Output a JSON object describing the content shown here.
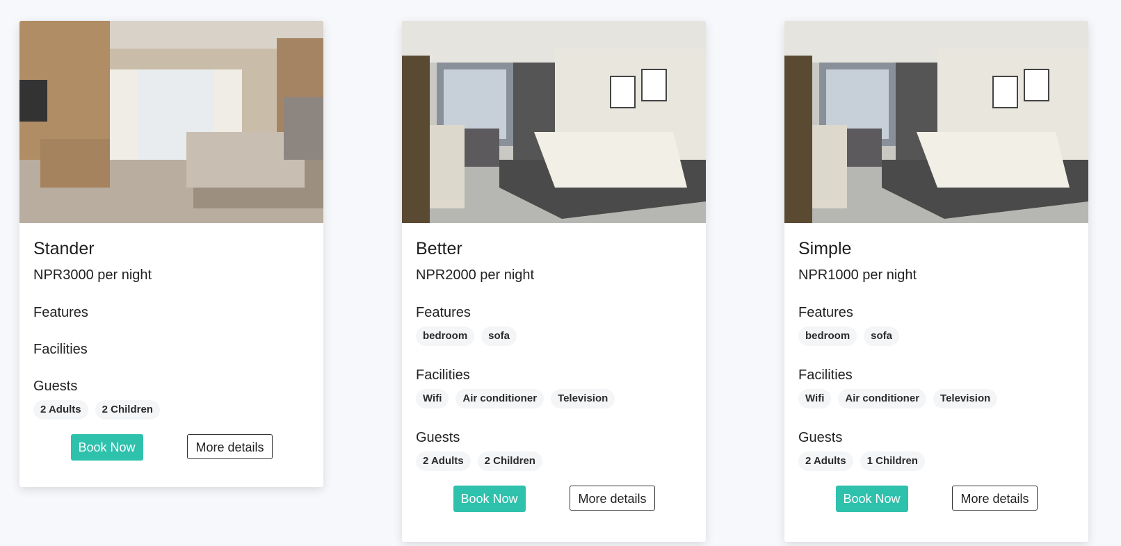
{
  "rooms": [
    {
      "name": "Stander",
      "price": "NPR3000 per night",
      "features_label": "Features",
      "features": [],
      "facilities_label": "Facilities",
      "facilities": [],
      "guests_label": "Guests",
      "guests": [
        "2 Adults",
        "2 Children"
      ],
      "book_label": "Book Now",
      "details_label": "More details"
    },
    {
      "name": "Better",
      "price": "NPR2000 per night",
      "features_label": "Features",
      "features": [
        "bedroom",
        "sofa"
      ],
      "facilities_label": "Facilities",
      "facilities": [
        "Wifi",
        "Air conditioner",
        "Television"
      ],
      "guests_label": "Guests",
      "guests": [
        "2 Adults",
        "2 Children"
      ],
      "book_label": "Book Now",
      "details_label": "More details"
    },
    {
      "name": "Simple",
      "price": "NPR1000 per night",
      "features_label": "Features",
      "features": [
        "bedroom",
        "sofa"
      ],
      "facilities_label": "Facilities",
      "facilities": [
        "Wifi",
        "Air conditioner",
        "Television"
      ],
      "guests_label": "Guests",
      "guests": [
        "2 Adults",
        "1 Children"
      ],
      "book_label": "Book Now",
      "details_label": "More details"
    }
  ],
  "colors": {
    "accent": "#2ec1ac",
    "page_bg": "#f6f8fb",
    "tag_bg": "#f4f5f7"
  }
}
